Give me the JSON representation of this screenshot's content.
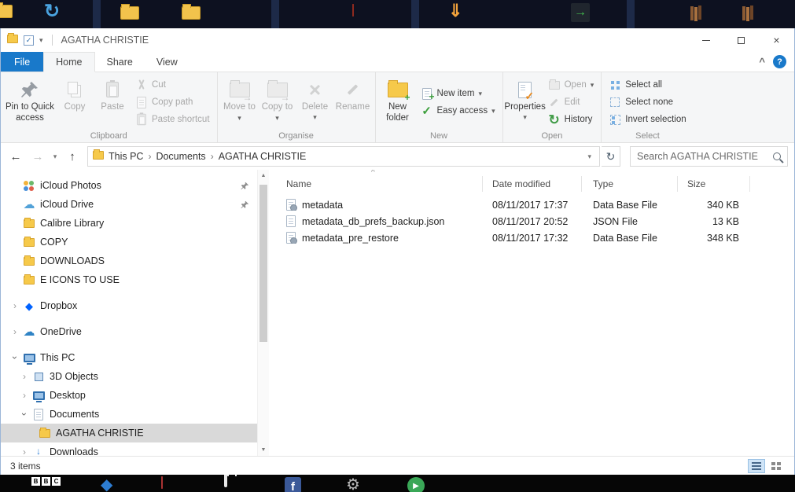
{
  "window": {
    "title": "AGATHA CHRISTIE"
  },
  "colors": {
    "accent": "#1979ca",
    "file_tab_bg": "#1979ca",
    "selected_sidebar_bg": "#d9d9d9"
  },
  "icons": {
    "close": "×",
    "help": "?",
    "collapse_ribbon": "^",
    "back": "←",
    "forward": "→",
    "up": "↑",
    "down_caret": "▾",
    "refresh": "↻",
    "breadcrumb_separator": "›",
    "tree_chevron": "›",
    "sort_ascending": "^",
    "scroll_up": "▲",
    "scroll_down": "▼",
    "arrow_right": "→",
    "arrow_down": "↓",
    "double_down": "⇓",
    "plus": "+",
    "check": "✓",
    "gear": "⚙",
    "play": "▶",
    "diamond": "◆",
    "cloud": "☁"
  },
  "tabs": [
    {
      "label": "File"
    },
    {
      "label": "Home"
    },
    {
      "label": "Share"
    },
    {
      "label": "View"
    }
  ],
  "ribbon": {
    "clipboard": {
      "label": "Clipboard",
      "pin": "Pin to Quick access",
      "copy": "Copy",
      "paste": "Paste",
      "cut": "Cut",
      "copy_path": "Copy path",
      "paste_shortcut": "Paste shortcut"
    },
    "organise": {
      "label": "Organise",
      "move_to": "Move to",
      "copy_to": "Copy to",
      "delete": "Delete",
      "rename": "Rename"
    },
    "new": {
      "label": "New",
      "new_folder": "New folder",
      "new_item": "New item",
      "easy_access": "Easy access"
    },
    "open": {
      "label": "Open",
      "properties": "Properties",
      "open": "Open",
      "edit": "Edit",
      "history": "History"
    },
    "select": {
      "label": "Select",
      "select_all": "Select all",
      "select_none": "Select none",
      "invert_selection": "Invert selection"
    }
  },
  "address": {
    "crumbs": [
      "This PC",
      "Documents",
      "AGATHA CHRISTIE"
    ],
    "search_placeholder": "Search AGATHA CHRISTIE"
  },
  "sidebar": {
    "items": [
      {
        "label": "iCloud Photos",
        "icon": "icloud-photos",
        "pinned": true
      },
      {
        "label": "iCloud Drive",
        "icon": "icloud-drive",
        "pinned": true
      },
      {
        "label": "Calibre Library",
        "icon": "folder"
      },
      {
        "label": "COPY",
        "icon": "folder"
      },
      {
        "label": "DOWNLOADS",
        "icon": "folder"
      },
      {
        "label": "E ICONS TO USE",
        "icon": "folder"
      },
      {
        "label": "Dropbox",
        "icon": "dropbox"
      },
      {
        "label": "OneDrive",
        "icon": "onedrive"
      },
      {
        "label": "This PC",
        "icon": "this-pc",
        "expanded": true
      },
      {
        "label": "3D Objects",
        "icon": "3d-objects"
      },
      {
        "label": "Desktop",
        "icon": "desktop"
      },
      {
        "label": "Documents",
        "icon": "documents",
        "expanded": true
      },
      {
        "label": "AGATHA CHRISTIE",
        "icon": "folder",
        "selected": true
      },
      {
        "label": "Downloads",
        "icon": "downloads"
      }
    ]
  },
  "files": {
    "columns": [
      {
        "label": "Name"
      },
      {
        "label": "Date modified"
      },
      {
        "label": "Type"
      },
      {
        "label": "Size"
      }
    ],
    "rows": [
      {
        "name": "metadata",
        "date_modified": "08/11/2017 17:37",
        "type": "Data Base File",
        "size": "340 KB"
      },
      {
        "name": "metadata_db_prefs_backup.json",
        "date_modified": "08/11/2017 20:52",
        "type": "JSON File",
        "size": "13 KB"
      },
      {
        "name": "metadata_pre_restore",
        "date_modified": "08/11/2017 17:32",
        "type": "Data Base File",
        "size": "348 KB"
      }
    ]
  },
  "status_bar": {
    "item_count": "3 items"
  },
  "taskbar": {
    "bbc_letters": [
      "B",
      "B",
      "C"
    ],
    "facebook_letter": "f"
  }
}
